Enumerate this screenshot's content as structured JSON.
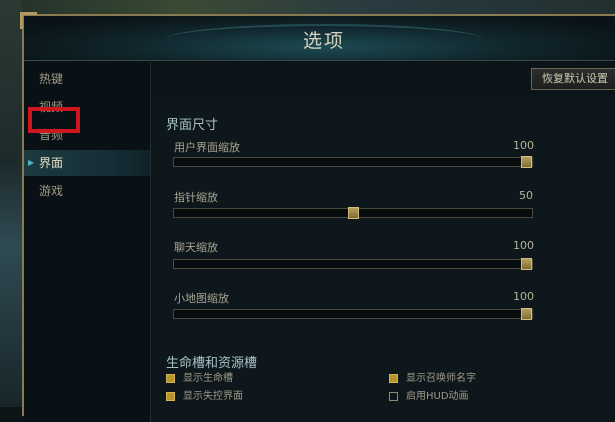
{
  "dialog": {
    "title": "选项"
  },
  "sidebar": {
    "items": [
      {
        "label": "热键",
        "active": false
      },
      {
        "label": "视频",
        "active": false,
        "highlighted": true
      },
      {
        "label": "音频",
        "active": false
      },
      {
        "label": "界面",
        "active": true
      },
      {
        "label": "游戏",
        "active": false
      }
    ]
  },
  "toolbar": {
    "reset_label": "恢复默认设置"
  },
  "interface_size": {
    "title": "界面尺寸",
    "sliders": [
      {
        "label": "用户界面缩放",
        "value": "100",
        "level": 1.0
      },
      {
        "label": "指针缩放",
        "value": "50",
        "level": 0.5
      },
      {
        "label": "聊天缩放",
        "value": "100",
        "level": 1.0
      },
      {
        "label": "小地图缩放",
        "value": "100",
        "level": 1.0
      }
    ]
  },
  "health_bars": {
    "title": "生命槽和资源槽",
    "options": [
      {
        "label": "显示生命槽",
        "checked": true
      },
      {
        "label": "显示召唤师名字",
        "checked": true
      },
      {
        "label": "显示失控界面",
        "checked": true
      },
      {
        "label": "启用HUD动画",
        "checked": false
      }
    ]
  },
  "colors": {
    "accent": "#b7952e",
    "highlight": "#d0161e",
    "active_tab": "#1c3a40"
  }
}
